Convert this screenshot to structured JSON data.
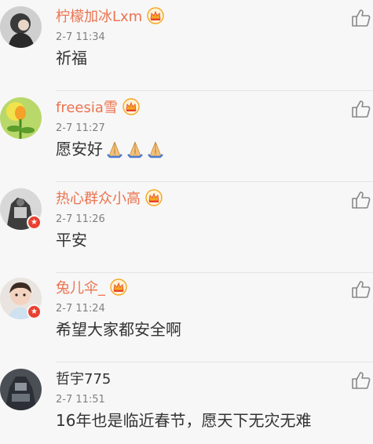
{
  "comments": [
    {
      "username": "柠檬加冰Lxm",
      "time": "2-7 11:34",
      "text": "祈福",
      "vip": true,
      "verified": false,
      "emoji_count": 0
    },
    {
      "username": "freesia雪",
      "time": "2-7 11:27",
      "text": "愿安好",
      "vip": true,
      "verified": false,
      "emoji_count": 3,
      "emoji": "folded-hands-icon"
    },
    {
      "username": "热心群众小高",
      "time": "2-7 11:26",
      "text": "平安",
      "vip": true,
      "verified": true,
      "emoji_count": 0
    },
    {
      "username": "兔儿伞_",
      "time": "2-7 11:24",
      "text": "希望大家都安全啊",
      "vip": true,
      "verified": true,
      "emoji_count": 0
    },
    {
      "username": "哲宇775",
      "time": "2-7 11:51",
      "text": "16年也是临近春节，愿天下无灾无难",
      "vip": false,
      "verified": false,
      "emoji_count": 0
    }
  ],
  "icons": {
    "like": "thumbs-up-outline-icon",
    "vip": "crown-icon",
    "verified": "star-badge-icon"
  },
  "colors": {
    "background": "#f7f7f7",
    "vip_name": "#eb7350",
    "plain_name": "#333333",
    "time": "#808080",
    "badge": "#e8412f",
    "crown": "#f5a623"
  }
}
